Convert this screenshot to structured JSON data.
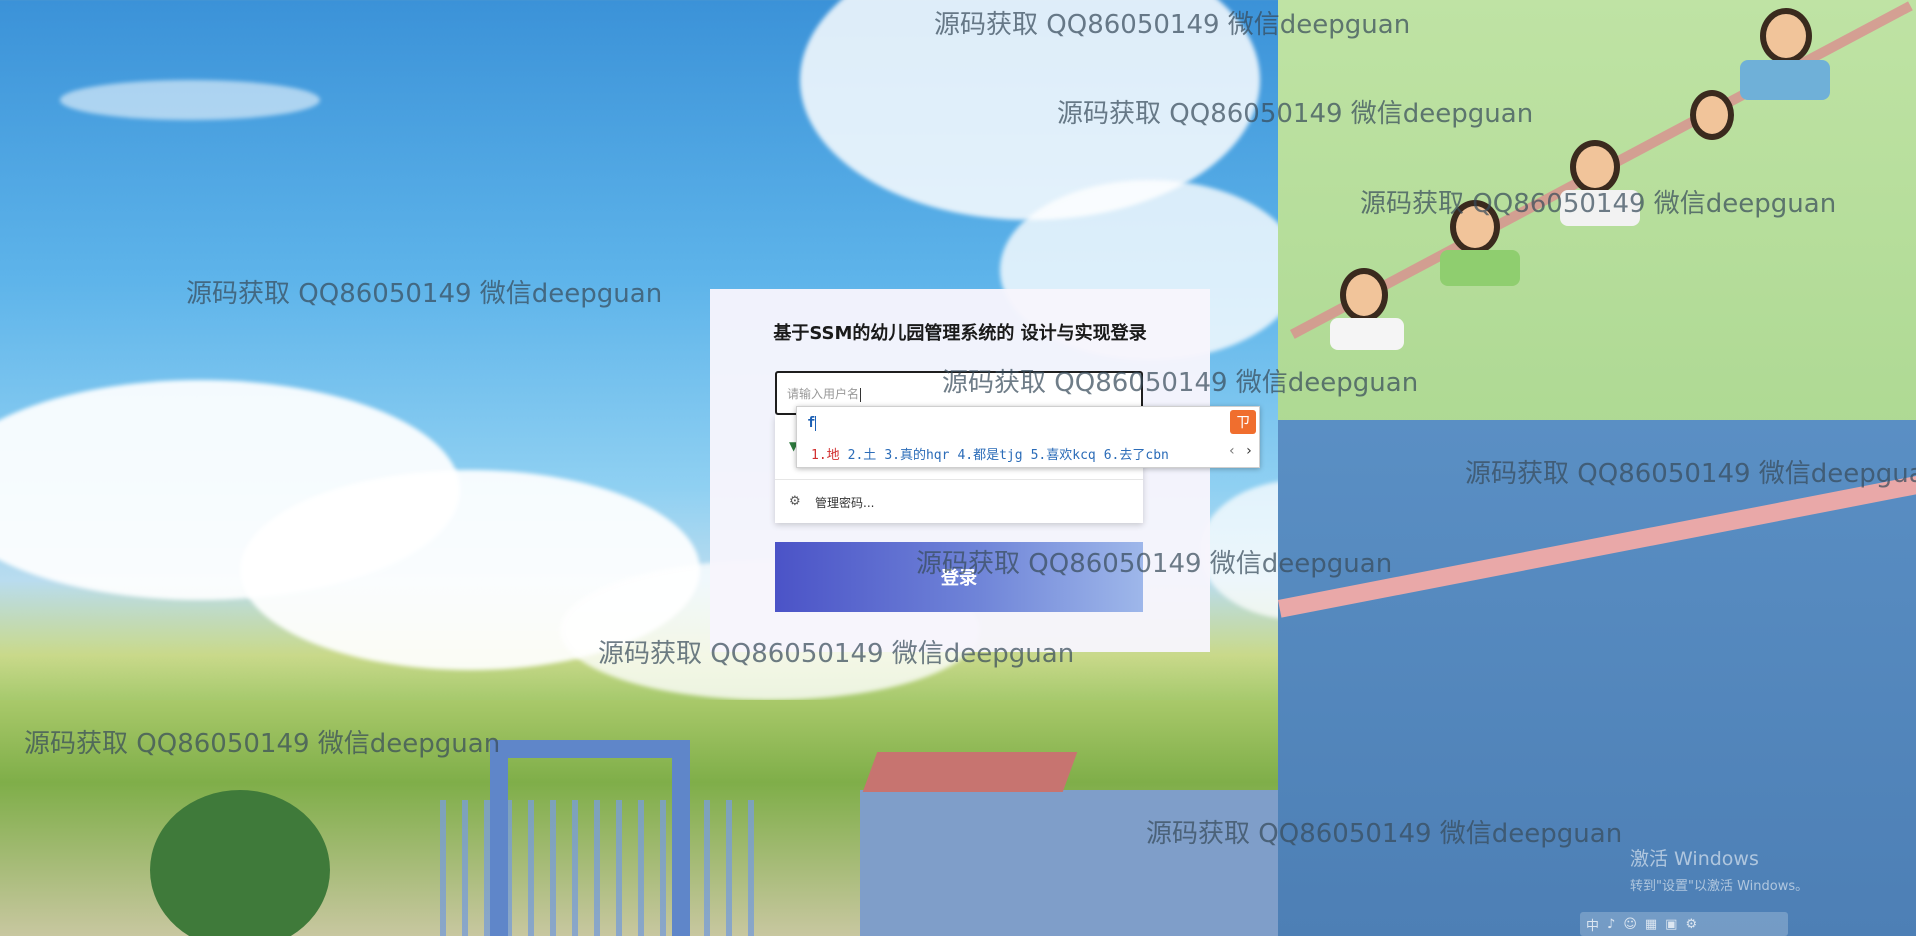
{
  "login": {
    "title": "基于SSM的幼儿园管理系统的 设计与实现登录",
    "username_placeholder": "请输入用户名",
    "manage_passwords": "管理密码...",
    "submit": "登录"
  },
  "ime": {
    "input": "f",
    "candidates": [
      "1.地",
      "2.土",
      "3.真的hqr",
      "4.都是tjg",
      "5.喜欢kcq",
      "6.去了cbn"
    ],
    "prev": "‹",
    "next": "›"
  },
  "watermark_text": "源码获取 QQ86050149 微信deepguan",
  "windows_activation": {
    "line1": "激活 Windows",
    "line2": "转到\"设置\"以激活 Windows。"
  },
  "taskbar_ime": [
    "中",
    "♪",
    "☺",
    "▦",
    "▣",
    "⚙"
  ],
  "colors": {
    "login_button_start": "#4b53c7",
    "login_button_end": "#9eb7ea",
    "ime_first_candidate": "#d12e2e",
    "ime_candidates": "#2b6cb8",
    "ime_logo": "#f06e2e"
  }
}
